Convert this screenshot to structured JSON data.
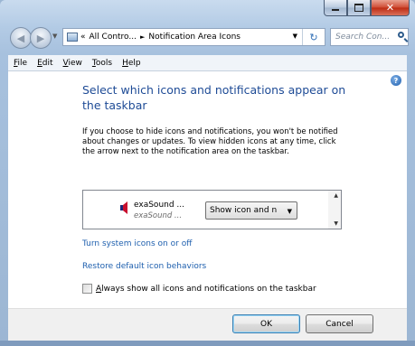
{
  "window": {
    "caption_buttons": {
      "minimize": "minimize-icon",
      "maximize": "maximize-icon",
      "close": "✕"
    }
  },
  "addressbar": {
    "prefix": "«",
    "segments": [
      "All Contro...",
      "Notification Area Icons"
    ],
    "separator": "►",
    "dropdown": "▼",
    "refresh": "↻"
  },
  "search": {
    "placeholder": "Search Con..."
  },
  "menu": [
    {
      "underline": "F",
      "rest": "ile"
    },
    {
      "underline": "E",
      "rest": "dit"
    },
    {
      "underline": "V",
      "rest": "iew"
    },
    {
      "underline": "T",
      "rest": "ools"
    },
    {
      "underline": "H",
      "rest": "elp"
    }
  ],
  "content": {
    "help": "?",
    "heading": "Select which icons and notifications appear on the taskbar",
    "description": "If you choose to hide icons and notifications, you won't be notified about changes or updates. To view hidden icons at any time, click the arrow next to the notification area on the taskbar.",
    "table": {
      "rows": [
        {
          "name": "exaSound ...",
          "subtitle": "exaSound ...",
          "behavior": "Show icon and n",
          "icon": "speaker-icon"
        }
      ]
    },
    "links": {
      "system_icons": "Turn system icons on or off",
      "restore": "Restore default icon behaviors"
    },
    "always_show": {
      "underline": "A",
      "rest": "lways show all icons and notifications on the taskbar",
      "checked": false
    }
  },
  "buttons": {
    "ok": "OK",
    "cancel": "Cancel"
  }
}
